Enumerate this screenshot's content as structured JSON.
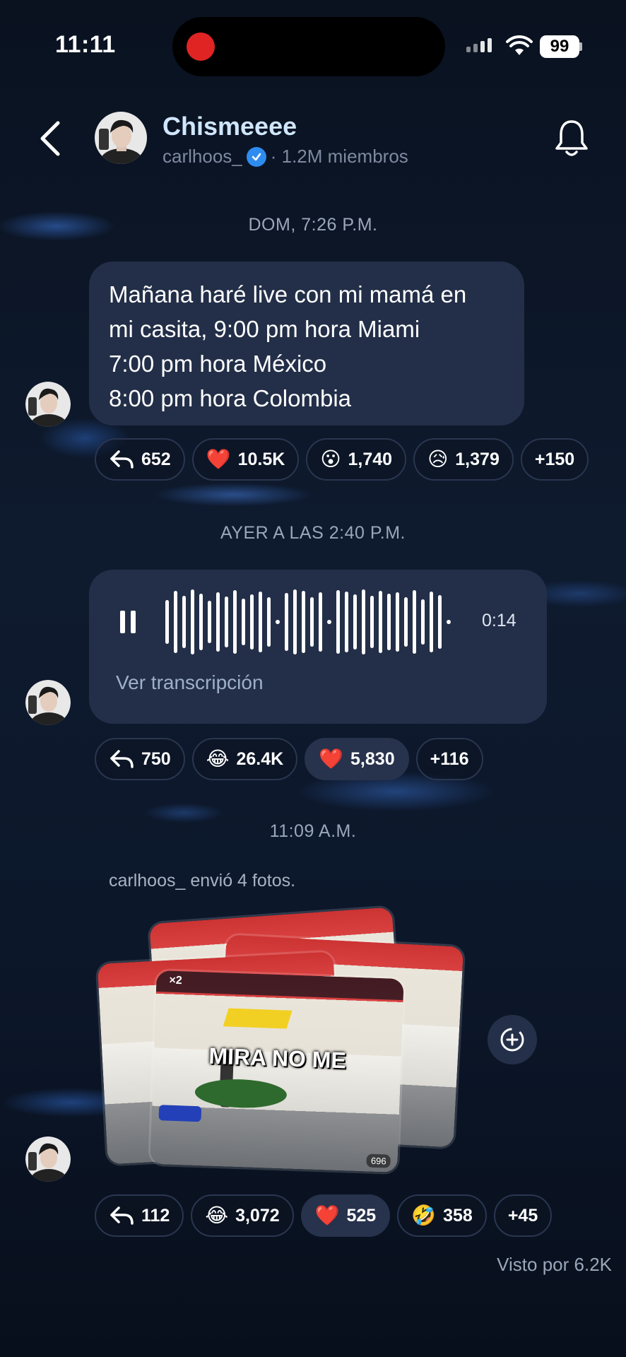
{
  "status_bar": {
    "time": "11:11",
    "battery": "99"
  },
  "header": {
    "title": "Chismeeee",
    "username": "carlhoos_",
    "members": "· 1.2M miembros"
  },
  "messages": [
    {
      "timestamp": "DOM, 7:26 P.M.",
      "lines": [
        "Mañana haré live con mi mamá en",
        "mi casita, 9:00 pm hora Miami",
        "7:00 pm hora México",
        "8:00 pm hora Colombia"
      ],
      "reactions": [
        {
          "icon": "reply-icon",
          "count": "652"
        },
        {
          "icon": "heart-emoji",
          "emoji": "❤️",
          "count": "10.5K"
        },
        {
          "icon": "surprised-emoji",
          "emoji": "😮",
          "count": "1,740"
        },
        {
          "icon": "sad-emoji",
          "emoji": "😥",
          "count": "1,379"
        },
        {
          "icon": "more",
          "count": "+150"
        }
      ]
    },
    {
      "timestamp": "AYER A LAS 2:40 P.M.",
      "audio": {
        "duration": "0:14",
        "transcript_link": "Ver transcripción"
      },
      "reactions": [
        {
          "icon": "reply-icon",
          "count": "750"
        },
        {
          "icon": "laughing-emoji",
          "emoji": "😂",
          "count": "26.4K"
        },
        {
          "icon": "heart-emoji",
          "emoji": "❤️",
          "count": "5,830"
        },
        {
          "icon": "more",
          "count": "+116"
        }
      ]
    },
    {
      "timestamp": "11:09 A.M.",
      "system_note": "carlhoos_ envió 4 fotos.",
      "photo": {
        "caption": "MIRA NO ME",
        "badge": "×2",
        "viewers": "696"
      },
      "reactions": [
        {
          "icon": "reply-icon",
          "count": "112"
        },
        {
          "icon": "laughing-emoji",
          "emoji": "😂",
          "count": "3,072"
        },
        {
          "icon": "heart-emoji",
          "emoji": "❤️",
          "count": "525"
        },
        {
          "icon": "rofl-emoji",
          "emoji": "🤣",
          "count": "358"
        },
        {
          "icon": "more",
          "count": "+45"
        }
      ]
    }
  ],
  "seen_by": "Visto por 6.2K",
  "colors": {
    "bubble": "#232f48",
    "accent": "#cfe6ff",
    "verified": "#2e8cf0",
    "record": "#e02424"
  }
}
